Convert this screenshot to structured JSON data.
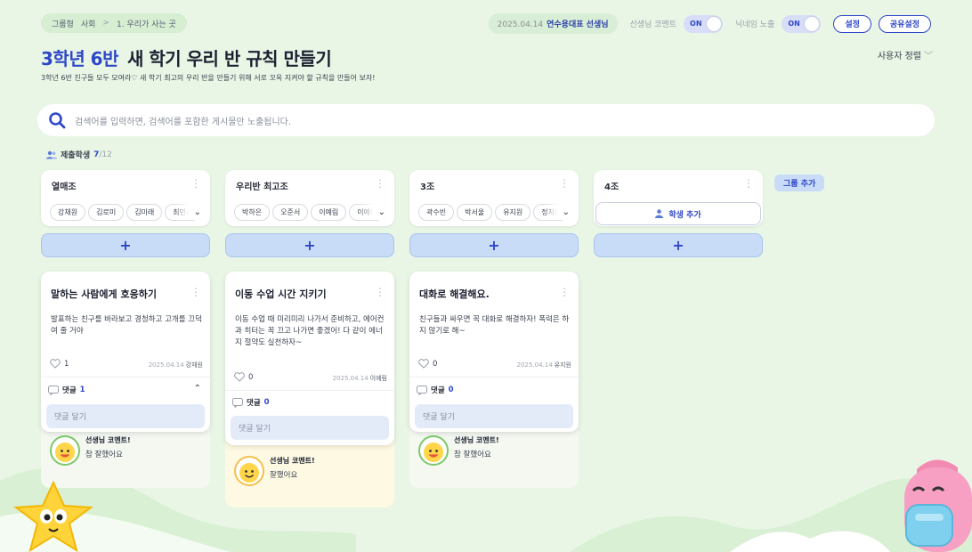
{
  "breadcrumb": {
    "type": "그룹형",
    "category": "사회",
    "sep": ">",
    "unit": "1. 우리가 사는 곳"
  },
  "header": {
    "date": "2025.04.14",
    "author": "연수용대표 선생님",
    "teacher_comment_label": "선생님 코멘트",
    "teacher_comment_state": "ON",
    "nickname_label": "닉네임 노출",
    "nickname_state": "ON",
    "settings_label": "설정",
    "share_label": "공유설정"
  },
  "board": {
    "class_name": "3학년 6반",
    "title": "새 학기 우리 반 규칙 만들기",
    "description": "3학년 6반 친구들 모두 모여라♡ 새 학기 최고의 우리 반을 만들기 위해 서로 꼬옥 지켜야 할 규칙을 만들어 보자!",
    "sort_label": "사용자 정렬"
  },
  "search": {
    "placeholder": "검색어를 입력하면, 검색어를 포함한 게시물만 노출됩니다."
  },
  "submission": {
    "label": "제출학생",
    "count": "7",
    "total": "/12"
  },
  "groups": [
    {
      "name": "열매조",
      "members": [
        "강채원",
        "김로미",
        "김미래",
        "최민서"
      ]
    },
    {
      "name": "우리반 최고조",
      "members": [
        "박하은",
        "오준서",
        "이예림",
        "이예린"
      ]
    },
    {
      "name": "3조",
      "members": [
        "곽수빈",
        "박서울",
        "유지원",
        "정지민"
      ]
    },
    {
      "name": "4조",
      "members": [],
      "add_student_label": "학생 추가"
    }
  ],
  "add_post_label": "+",
  "add_group_label": "그룹 추가",
  "posts": [
    {
      "title": "말하는 사람에게 호응하기",
      "body": "발표하는 친구를 바라보고 경청하고 고개를 끄덕여 줄 거야",
      "likes": "1",
      "date": "2025.04.14",
      "author": "강채원",
      "comment_label": "댓글",
      "comment_count": "1",
      "comment_placeholder": "댓글 달기",
      "teacher_title": "선생님 코멘트!",
      "teacher_text": "참 잘했어요"
    },
    {
      "title": "이동 수업 시간 지키기",
      "body": "이동 수업 때 미리미리 나가서 준비하고, 에어컨과 히터는 꼭 끄고 나가면 좋겠어! 다 같이 에너지 절약도 실천하자~",
      "likes": "0",
      "date": "2025.04.14",
      "author": "이예림",
      "comment_label": "댓글",
      "comment_count": "0",
      "comment_placeholder": "댓글 달기",
      "teacher_title": "선생님 코멘트!",
      "teacher_text": "잘했어요"
    },
    {
      "title": "대화로 해결해요.",
      "body": "친구들과 싸우면 꼭 대화로 해결하자! 폭력은 하지 않기로 해~",
      "likes": "0",
      "date": "2025.04.14",
      "author": "유지원",
      "comment_label": "댓글",
      "comment_count": "0",
      "comment_placeholder": "댓글 달기",
      "teacher_title": "선생님 코멘트!",
      "teacher_text": "참 잘했어요"
    }
  ],
  "colors": {
    "accent": "#2e47c7",
    "background": "#e9f6e6",
    "plus_button": "#c9dcf7"
  }
}
